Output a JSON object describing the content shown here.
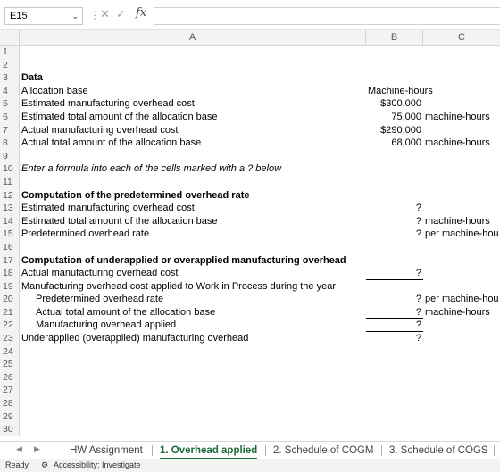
{
  "formula_bar": {
    "name_box": "E15",
    "fx_label": "fx",
    "formula": ""
  },
  "columns": [
    "A",
    "B",
    "C"
  ],
  "rows": [
    {
      "n": "1"
    },
    {
      "n": "2"
    },
    {
      "n": "3",
      "a": "Data",
      "a_bold": true
    },
    {
      "n": "4",
      "a": "Allocation base",
      "b": "Machine-hours",
      "b_left": true
    },
    {
      "n": "5",
      "a": "Estimated manufacturing overhead cost",
      "b": "$300,000"
    },
    {
      "n": "6",
      "a": "Estimated total amount of the allocation base",
      "b": "75,000",
      "c": "machine-hours"
    },
    {
      "n": "7",
      "a": "Actual manufacturing overhead cost",
      "b": "$290,000"
    },
    {
      "n": "8",
      "a": "Actual total amount of the allocation base",
      "b": "68,000",
      "c": "machine-hours"
    },
    {
      "n": "9"
    },
    {
      "n": "10",
      "a": "Enter a formula into each of the cells marked with a ? below",
      "a_italic": true
    },
    {
      "n": "11"
    },
    {
      "n": "12",
      "a": "Computation of the predetermined overhead rate",
      "a_bold": true
    },
    {
      "n": "13",
      "a": "Estimated manufacturing overhead cost",
      "b": "?"
    },
    {
      "n": "14",
      "a": "Estimated total amount of the allocation base",
      "b": "?",
      "c": "machine-hours"
    },
    {
      "n": "15",
      "a": "Predetermined overhead rate",
      "b": "?",
      "c": "per machine-hou"
    },
    {
      "n": "16"
    },
    {
      "n": "17",
      "a": "Computation of underapplied or overapplied manufacturing overhead",
      "a_bold": true
    },
    {
      "n": "18",
      "a": "Actual manufacturing overhead cost",
      "b": "?",
      "b_border_bottom": true
    },
    {
      "n": "19",
      "a": "Manufacturing overhead cost applied to Work in Process during the year:"
    },
    {
      "n": "20",
      "a": "Predetermined overhead rate",
      "a_indent": true,
      "b": "?",
      "c": "per machine-hou"
    },
    {
      "n": "21",
      "a": "Actual total amount of the allocation base",
      "a_indent": true,
      "b": "?",
      "c": "machine-hours",
      "b_border_bottom": true
    },
    {
      "n": "22",
      "a": "Manufacturing overhead applied",
      "a_indent": true,
      "b": "?",
      "b_border_bottom": true
    },
    {
      "n": "23",
      "a": "Underapplied (overapplied) manufacturing overhead",
      "b": "?"
    },
    {
      "n": "24"
    },
    {
      "n": "25"
    },
    {
      "n": "26"
    },
    {
      "n": "27"
    },
    {
      "n": "28"
    },
    {
      "n": "29"
    },
    {
      "n": "30"
    }
  ],
  "sheet_tabs": [
    {
      "label": "HW Assignment",
      "active": false
    },
    {
      "label": "1. Overhead applied",
      "active": true
    },
    {
      "label": "2. Schedule of COGM",
      "active": false
    },
    {
      "label": "3. Schedule of COGS",
      "active": false
    }
  ],
  "status_bar": {
    "ready": "Ready",
    "accessibility": "Accessibility: Investigate"
  },
  "colors": {
    "active_tab": "#1e6b3a",
    "header_bg": "#f3f3f3"
  }
}
